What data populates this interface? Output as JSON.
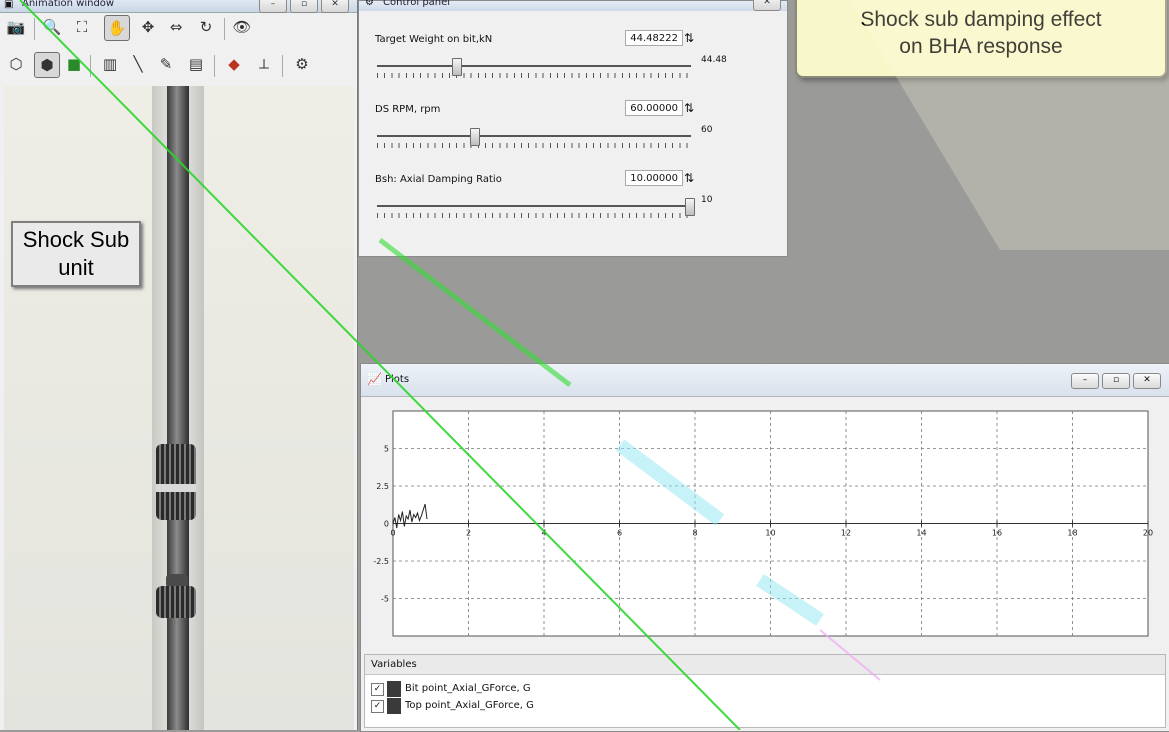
{
  "animation_window": {
    "title": "Animation window",
    "callout": {
      "line1": "Shock Sub",
      "line2": "unit"
    }
  },
  "control_panel": {
    "title": "Control panel",
    "params": [
      {
        "label": "Target Weight on bit,kN",
        "value": "44.48222",
        "slider_value": "44.48",
        "position": 0.24
      },
      {
        "label": "DS RPM, rpm",
        "value": "60.00000",
        "slider_value": "60",
        "position": 0.3
      },
      {
        "label": "Bsh: Axial Damping Ratio",
        "value": "10.00000",
        "slider_value": "10",
        "position": 1.0
      }
    ]
  },
  "callout": {
    "line1": "Shock sub damping effect",
    "line2": "on BHA response"
  },
  "plots": {
    "title": "Plots",
    "variables_header": "Variables",
    "variables": [
      {
        "name": "Bit point_Axial_GForce, G",
        "checked": true
      },
      {
        "name": "Top point_Axial_GForce, G",
        "checked": true
      }
    ]
  },
  "chart_data": {
    "type": "line",
    "xlim": [
      0,
      20
    ],
    "ylim": [
      -7.5,
      7.5
    ],
    "x_ticks": [
      "0",
      "2",
      "4",
      "6",
      "8",
      "10",
      "12",
      "14",
      "16",
      "18",
      "20"
    ],
    "y_ticks": [
      "5",
      "2.5",
      "0",
      "-2.5",
      "-5"
    ],
    "grid": true,
    "series": [
      {
        "name": "Bit point_Axial_GForce, G",
        "color": "#222222",
        "x": [
          0.0,
          0.05,
          0.1,
          0.15,
          0.2,
          0.25,
          0.3,
          0.35,
          0.4,
          0.45,
          0.5,
          0.55,
          0.6,
          0.65,
          0.7,
          0.75,
          0.8,
          0.85,
          0.9
        ],
        "y": [
          0.0,
          0.4,
          -0.3,
          0.6,
          0.2,
          0.8,
          -0.2,
          0.5,
          0.3,
          0.9,
          0.1,
          0.6,
          0.4,
          0.7,
          0.2,
          0.5,
          0.9,
          1.3,
          0.3
        ]
      }
    ]
  }
}
